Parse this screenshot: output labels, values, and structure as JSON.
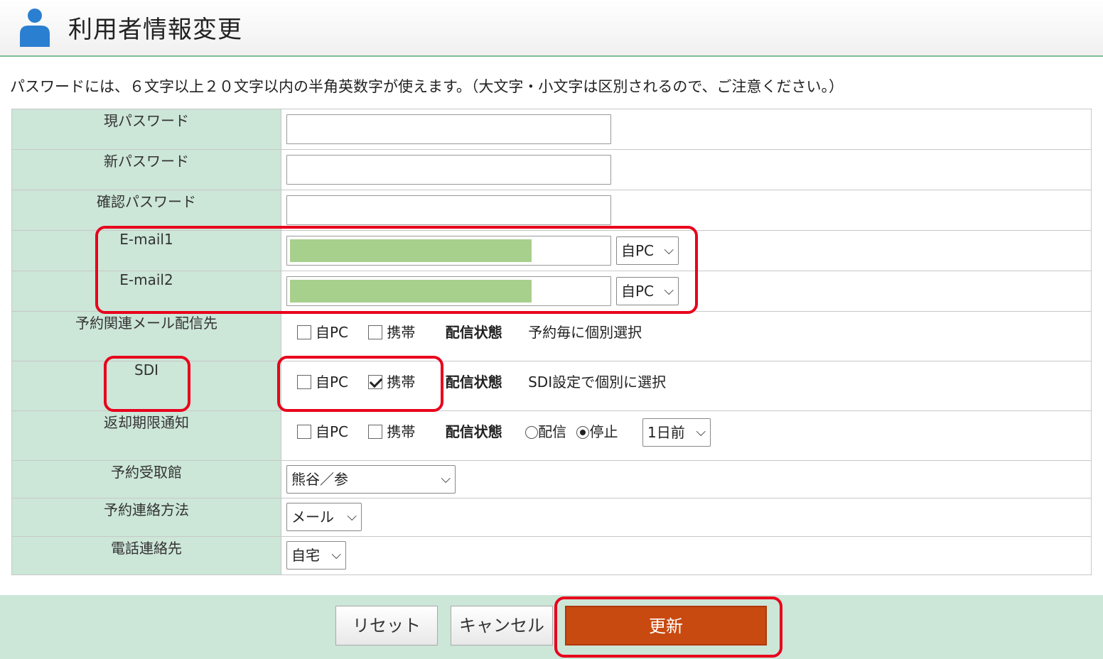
{
  "header": {
    "title": "利用者情報変更",
    "icon": "user-icon"
  },
  "notice": "パスワードには、６文字以上２０文字以内の半角英数字が使えます。（大文字・小文字は区別されるので、ご注意ください。）",
  "form": {
    "current_password": {
      "label": "現パスワード",
      "value": ""
    },
    "new_password": {
      "label": "新パスワード",
      "value": ""
    },
    "confirm_password": {
      "label": "確認パスワード",
      "value": ""
    },
    "email1": {
      "label": "E-mail1",
      "value": "",
      "type": "自PC"
    },
    "email2": {
      "label": "E-mail2",
      "value": "",
      "type": "自PC"
    },
    "reservation_mail": {
      "label": "予約関連メール配信先",
      "opt_pc": "自PC",
      "pc_checked": false,
      "opt_mobile": "携帯",
      "mobile_checked": false,
      "status_label": "配信状態",
      "status_text": "予約毎に個別選択"
    },
    "sdi": {
      "label": "SDI",
      "opt_pc": "自PC",
      "pc_checked": false,
      "opt_mobile": "携帯",
      "mobile_checked": true,
      "status_label": "配信状態",
      "status_text": "SDI設定で個別に選択"
    },
    "return_notice": {
      "label": "返却期限通知",
      "opt_pc": "自PC",
      "pc_checked": false,
      "opt_mobile": "携帯",
      "mobile_checked": false,
      "status_label": "配信状態",
      "radio_on": "配信",
      "radio_off": "停止",
      "radio_selected": "停止",
      "timing": "1日前"
    },
    "pickup_library": {
      "label": "予約受取館",
      "value": "熊谷／参"
    },
    "contact_method": {
      "label": "予約連絡方法",
      "value": "メール"
    },
    "phone_contact": {
      "label": "電話連絡先",
      "value": "自宅"
    }
  },
  "buttons": {
    "reset": "リセット",
    "cancel": "キャンセル",
    "update": "更新"
  },
  "colors": {
    "label_bg": "#cce6d8",
    "accent": "#c84a10",
    "highlight": "#e8001c",
    "mask": "#a8d08d"
  }
}
